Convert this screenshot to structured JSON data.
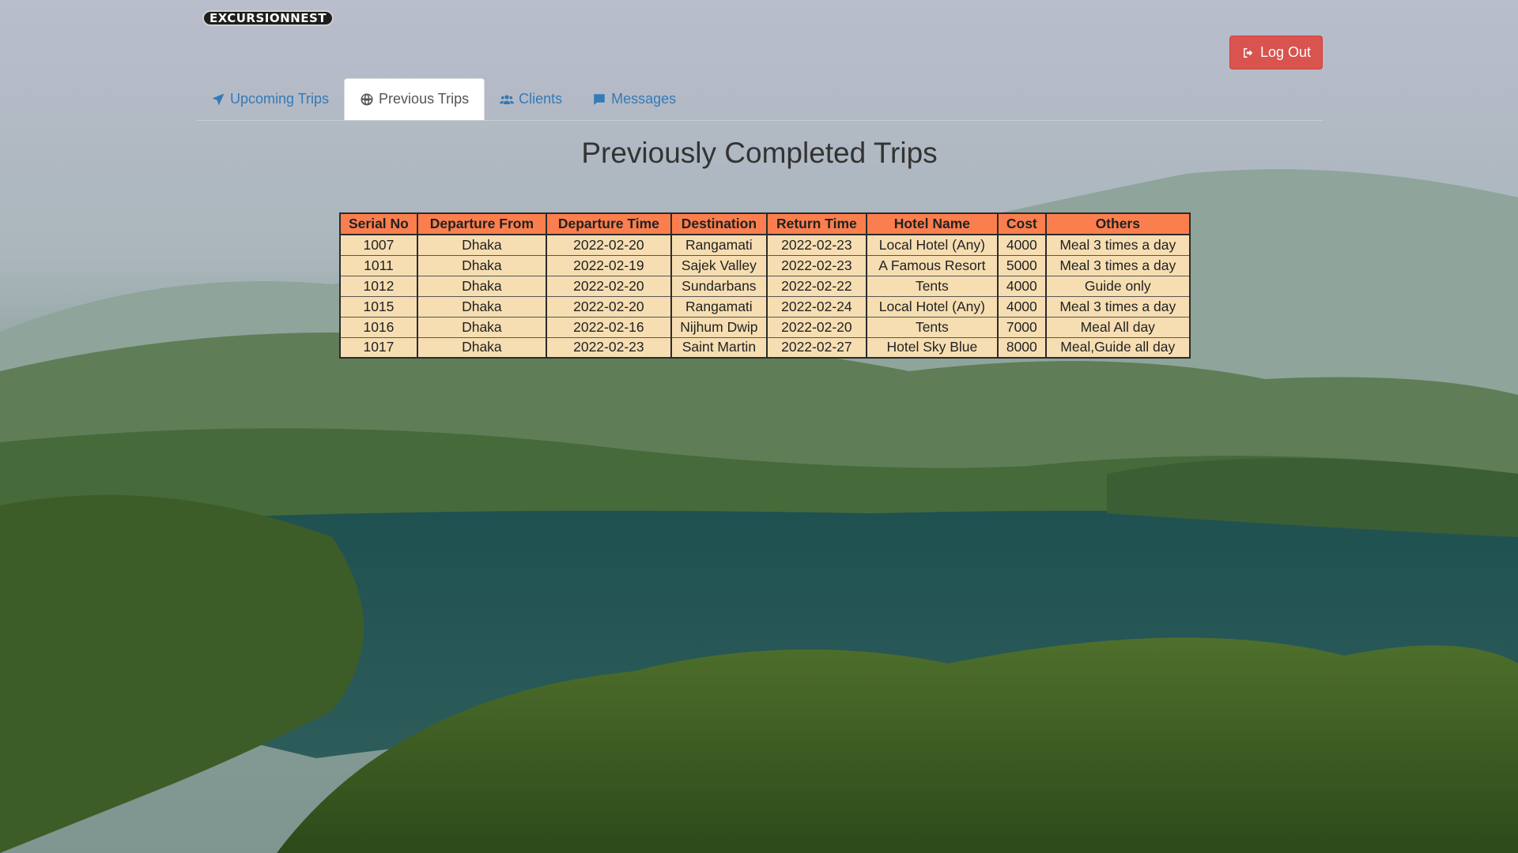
{
  "brand": {
    "logo_text": "EXCURSIONNEST"
  },
  "header": {
    "logout_label": "Log Out"
  },
  "tabs": [
    {
      "label": "Upcoming Trips",
      "icon": "paper-plane-icon"
    },
    {
      "label": "Previous Trips",
      "icon": "globe-icon",
      "active": true
    },
    {
      "label": "Clients",
      "icon": "users-icon"
    },
    {
      "label": "Messages",
      "icon": "comment-icon"
    }
  ],
  "main": {
    "title": "Previously Completed Trips",
    "table": {
      "headers": [
        "Serial No",
        "Departure From",
        "Departure Time",
        "Destination",
        "Return Time",
        "Hotel Name",
        "Cost",
        "Others"
      ],
      "rows": [
        [
          "1007",
          "Dhaka",
          "2022-02-20",
          "Rangamati",
          "2022-02-23",
          "Local Hotel (Any)",
          "4000",
          "Meal 3 times a day"
        ],
        [
          "1011",
          "Dhaka",
          "2022-02-19",
          "Sajek Valley",
          "2022-02-23",
          "A Famous Resort",
          "5000",
          "Meal 3 times a day"
        ],
        [
          "1012",
          "Dhaka",
          "2022-02-20",
          "Sundarbans",
          "2022-02-22",
          "Tents",
          "4000",
          "Guide only"
        ],
        [
          "1015",
          "Dhaka",
          "2022-02-20",
          "Rangamati",
          "2022-02-24",
          "Local Hotel (Any)",
          "4000",
          "Meal 3 times a day"
        ],
        [
          "1016",
          "Dhaka",
          "2022-02-16",
          "Nijhum Dwip",
          "2022-02-20",
          "Tents",
          "7000",
          "Meal All day"
        ],
        [
          "1017",
          "Dhaka",
          "2022-02-23",
          "Saint Martin",
          "2022-02-27",
          "Hotel Sky Blue",
          "8000",
          "Meal,Guide all day"
        ]
      ]
    }
  },
  "colors": {
    "table_header": "#fb7f4e",
    "table_row": "#f6deb2",
    "logout_button": "#d9534f",
    "link": "#337ab7"
  }
}
